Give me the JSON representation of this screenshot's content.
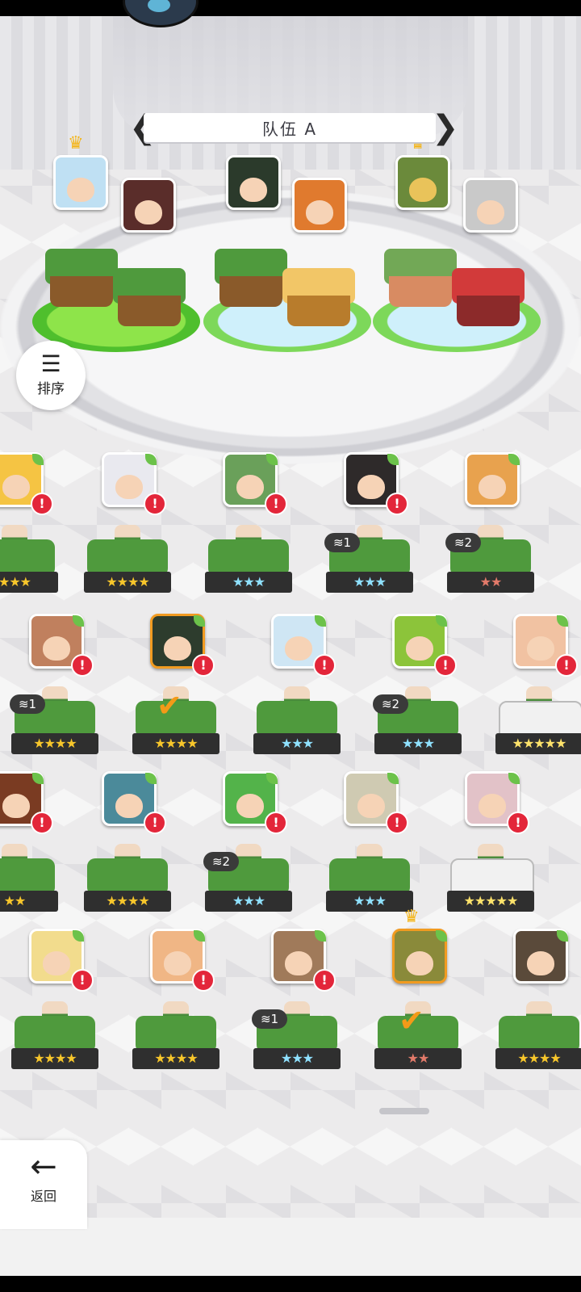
{
  "header": {
    "team_name": "队伍 A"
  },
  "controls": {
    "sort_label": "排序",
    "back_label": "返回"
  },
  "colors": {
    "alert": "#e3263a",
    "selected_border": "#f19b21",
    "plate_green": "#7ddb47",
    "plate_blue": "#cff0fb"
  },
  "roster": [
    {
      "tag": "",
      "stars": "★★★",
      "color": "gold",
      "alert": "!"
    },
    {
      "tag": "",
      "stars": "★★★★",
      "color": "gold",
      "alert": "!"
    },
    {
      "tag": "",
      "stars": "★★★",
      "color": "blue",
      "alert": "!"
    },
    {
      "tag": "≋1",
      "stars": "★★★",
      "color": "blue",
      "alert": "!"
    },
    {
      "tag": "≋2",
      "stars": "★★",
      "color": "red",
      "alert": ""
    },
    {
      "tag": "≋1",
      "stars": "★★★★",
      "color": "gold",
      "alert": "!"
    },
    {
      "tag": "",
      "stars": "★★★★",
      "color": "gold",
      "alert": "!"
    },
    {
      "tag": "",
      "stars": "★★★",
      "color": "blue",
      "alert": "!"
    },
    {
      "tag": "≋2",
      "stars": "★★★",
      "color": "blue",
      "alert": "!"
    },
    {
      "tag": "",
      "stars": "★★★★★",
      "color": "rainbow",
      "alert": "!"
    },
    {
      "tag": "",
      "stars": "★★",
      "color": "gold",
      "alert": "!"
    },
    {
      "tag": "",
      "stars": "★★★★",
      "color": "gold",
      "alert": "!"
    },
    {
      "tag": "≋2",
      "stars": "★★★",
      "color": "blue",
      "alert": "!"
    },
    {
      "tag": "",
      "stars": "★★★",
      "color": "blue",
      "alert": "!"
    },
    {
      "tag": "",
      "stars": "★★★★★",
      "color": "rainbow",
      "alert": "!"
    },
    {
      "tag": "",
      "stars": "★★★★",
      "color": "gold",
      "alert": "!"
    },
    {
      "tag": "",
      "stars": "★★★★",
      "color": "gold",
      "alert": "!"
    },
    {
      "tag": "≋1",
      "stars": "★★★",
      "color": "blue",
      "alert": "!"
    },
    {
      "tag": "",
      "stars": "★★",
      "color": "red",
      "alert": ""
    },
    {
      "tag": "",
      "stars": "★★★★",
      "color": "gold",
      "alert": ""
    }
  ]
}
